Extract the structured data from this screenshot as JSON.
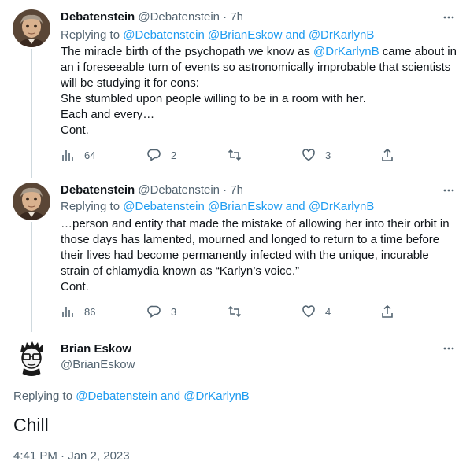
{
  "tweets": [
    {
      "name": "Debatenstein",
      "handle": "@Debatenstein",
      "separator": "·",
      "time": "7h",
      "replying_prefix": "Replying to",
      "replying_mentions": "@Debatenstein @BrianEskow",
      "replying_and": "and",
      "replying_last": "@DrKarlynB",
      "lines": [
        {
          "pre": "The miracle birth of the psychopath we know as ",
          "mention": "@DrKarlynB",
          "post": " came about in"
        },
        {
          "pre": "an i foreseeable turn of events so astronomically improbable that scientists",
          "mention": "",
          "post": ""
        },
        {
          "pre": "will be studying it for eons:",
          "mention": "",
          "post": ""
        },
        {
          "pre": "She stumbled upon people willing to be in a room with her.",
          "mention": "",
          "post": ""
        },
        {
          "pre": "Each and every…",
          "mention": "",
          "post": ""
        },
        {
          "pre": "Cont.",
          "mention": "",
          "post": ""
        }
      ],
      "views": "64",
      "replies": "2",
      "retweets": "",
      "likes": "3"
    },
    {
      "name": "Debatenstein",
      "handle": "@Debatenstein",
      "separator": "·",
      "time": "7h",
      "replying_prefix": "Replying to",
      "replying_mentions": "@Debatenstein @BrianEskow",
      "replying_and": "and",
      "replying_last": "@DrKarlynB",
      "lines": [
        {
          "pre": "…person and entity that made the mistake of allowing her into their orbit in",
          "mention": "",
          "post": ""
        },
        {
          "pre": "those days has lamented, mourned and longed to return to a time before",
          "mention": "",
          "post": ""
        },
        {
          "pre": "their lives had become permanently infected with the unique, incurable",
          "mention": "",
          "post": ""
        },
        {
          "pre": "strain of chlamydia known as “Karlyn’s voice.”",
          "mention": "",
          "post": ""
        },
        {
          "pre": "Cont.",
          "mention": "",
          "post": ""
        }
      ],
      "views": "86",
      "replies": "3",
      "retweets": "",
      "likes": "4"
    }
  ],
  "main": {
    "name": "Brian Eskow",
    "handle": "@BrianEskow",
    "replying_prefix": "Replying to",
    "replying_first": "@Debatenstein",
    "replying_and": "and",
    "replying_last": "@DrKarlynB",
    "text": "Chill",
    "timestamp": "4:41 PM · Jan 2, 2023"
  },
  "colors": {
    "link": "#1d9bf0",
    "muted": "#536471",
    "text": "#0f1419",
    "thread_line": "#cfd9de"
  },
  "icons": [
    "views-icon",
    "reply-icon",
    "retweet-icon",
    "like-icon",
    "share-icon",
    "more-icon"
  ]
}
